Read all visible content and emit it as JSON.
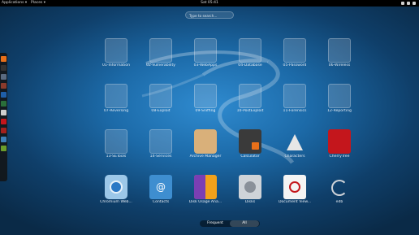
{
  "topbar": {
    "applications": "Applications",
    "places": "Places",
    "clock": "Sat 05:41"
  },
  "search": {
    "placeholder": "Type to search..."
  },
  "folders": [
    {
      "label": "01-Information"
    },
    {
      "label": "02-Vulnerability"
    },
    {
      "label": "03-WebApps"
    },
    {
      "label": "04-Database"
    },
    {
      "label": "05-Password"
    },
    {
      "label": "06-Wireless"
    },
    {
      "label": "07-Reversing"
    },
    {
      "label": "08-Exploit"
    },
    {
      "label": "09-Sniffing"
    },
    {
      "label": "10-PostExploit"
    },
    {
      "label": "11-Forensics"
    },
    {
      "label": "12-Reporting"
    },
    {
      "label": "13-SETools"
    },
    {
      "label": "14-Services"
    }
  ],
  "apps": [
    {
      "label": "Archive Manager"
    },
    {
      "label": "Calculator"
    },
    {
      "label": "Characters"
    },
    {
      "label": "CherryTree"
    },
    {
      "label": "Chromium Web..."
    },
    {
      "label": "Contacts"
    },
    {
      "label": "Disk Usage Ana..."
    },
    {
      "label": "Disks"
    },
    {
      "label": "Document View..."
    },
    {
      "label": "edb"
    }
  ],
  "tabs": {
    "frequent": "Frequent",
    "all": "All"
  },
  "colors": {
    "topbar": "#000000",
    "background": "#1c6aa8",
    "accent_cherry": "#c4161c"
  }
}
